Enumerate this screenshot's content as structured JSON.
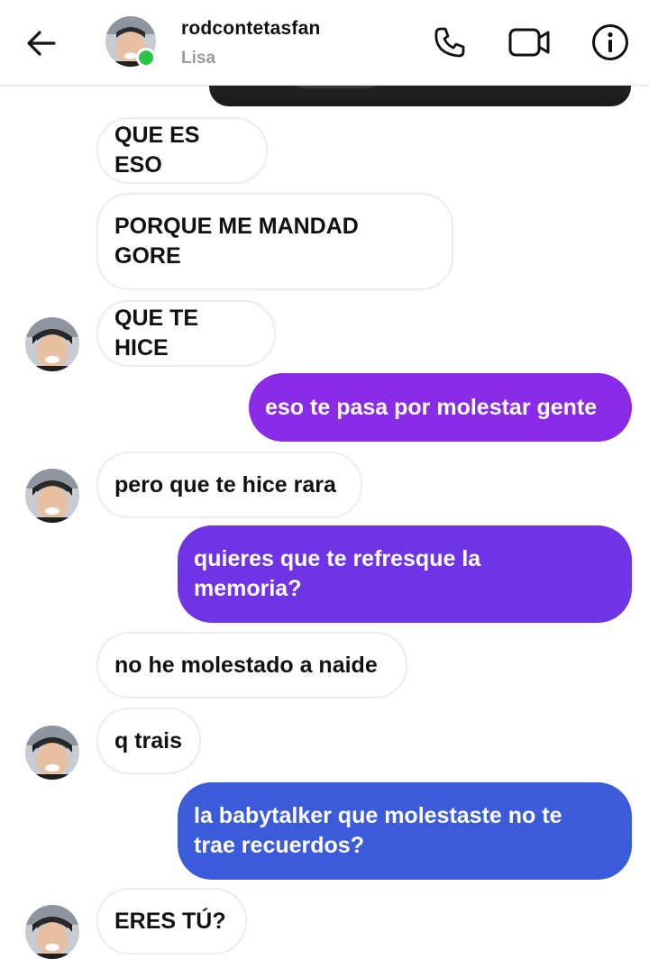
{
  "header": {
    "contact_name": "rodcontetasfan",
    "contact_subtitle": "Lisa",
    "online_color": "#2bc44b",
    "icons": [
      "back-arrow-icon",
      "phone-icon",
      "video-camera-icon",
      "info-icon"
    ]
  },
  "colors": {
    "outgoing_gradient_start": "#8a2be8",
    "outgoing_gradient_end": "#3b5bdb",
    "incoming_bubble": "#ffffff",
    "incoming_border": "#ececec"
  },
  "messages": [
    {
      "direction": "in",
      "text": "QUE ES ESO"
    },
    {
      "direction": "in",
      "text": "PORQUE ME MANDAD\nGORE"
    },
    {
      "direction": "in",
      "text": "QUE TE HICE"
    },
    {
      "direction": "out",
      "text": "eso te pasa por molestar gente"
    },
    {
      "direction": "in",
      "text": "pero que te hice rara"
    },
    {
      "direction": "out",
      "text": "quieres que te refresque la\nmemoria?"
    },
    {
      "direction": "in",
      "text": "no he molestado a naide"
    },
    {
      "direction": "in",
      "text": "q trais"
    },
    {
      "direction": "out",
      "text": "la babytalker que molestaste no te\ntrae recuerdos?"
    },
    {
      "direction": "in",
      "text": "ERES TÚ?"
    }
  ]
}
